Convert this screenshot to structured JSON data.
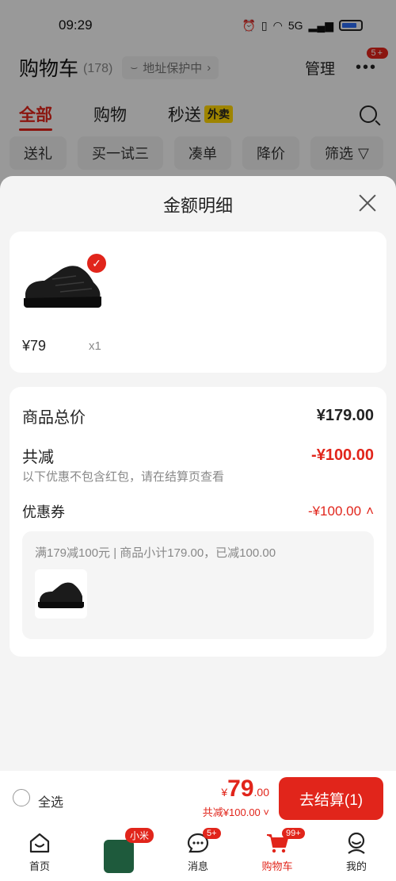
{
  "status_bar": {
    "time": "09:29",
    "network": "5G",
    "battery_color": "#2a6bf2"
  },
  "header": {
    "title": "购物车",
    "count": "(178)",
    "address_pill": "地址保护中",
    "manage_label": "管理",
    "more_badge": "5+"
  },
  "tabs": [
    {
      "label": "全部",
      "active": true
    },
    {
      "label": "购物",
      "active": false
    },
    {
      "label": "秒送",
      "tag": "外卖",
      "active": false
    }
  ],
  "filters": [
    "送礼",
    "买一试三",
    "凑单",
    "降价",
    "筛选"
  ],
  "sheet": {
    "title": "金额明细",
    "product": {
      "price": "¥79",
      "qty": "x1"
    },
    "summary": {
      "total_label": "商品总价",
      "total_value": "¥179.00",
      "discount_label": "共减",
      "discount_value": "-¥100.00",
      "discount_note": "以下优惠不包含红包，请在结算页查看",
      "coupon_label": "优惠券",
      "coupon_value": "-¥100.00",
      "coupon_detail": "满179减100元 | 商品小计179.00，已减100.00"
    }
  },
  "checkout": {
    "select_all_label": "全选",
    "currency": "¥",
    "amount_int": "79",
    "amount_dec": ".00",
    "saved": "共减¥100.00",
    "button_label": "去结算(1)"
  },
  "tabbar": [
    {
      "label": "首页",
      "icon": "home-icon"
    },
    {
      "label": "",
      "icon": "xiaomi-phone-promo",
      "badge": "小米"
    },
    {
      "label": "消息",
      "icon": "message-icon",
      "badge": "5+"
    },
    {
      "label": "购物车",
      "icon": "cart-icon",
      "badge": "99+",
      "active": true
    },
    {
      "label": "我的",
      "icon": "profile-icon"
    }
  ],
  "colors": {
    "accent": "#e1251b",
    "waimai_tag": "#ffd600"
  }
}
